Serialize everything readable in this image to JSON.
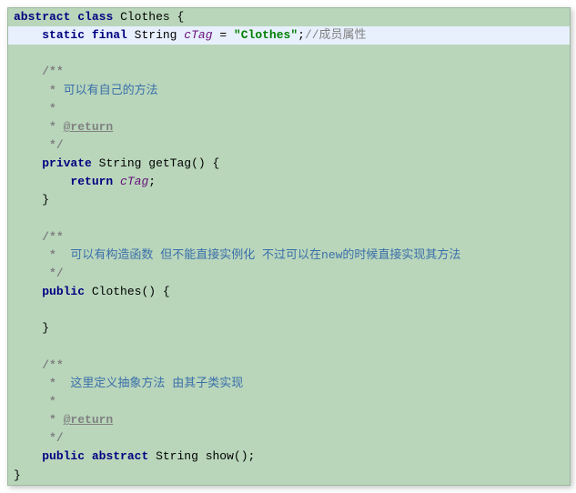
{
  "code": {
    "line1": {
      "kw_abstract": "abstract",
      "kw_class": "class",
      "class_name": "Clothes",
      "brace": "{"
    },
    "line2": {
      "kw_static": "static",
      "kw_final": "final",
      "type": "String",
      "field": "cTag",
      "eq": " = ",
      "str": "\"Clothes\"",
      "semi": ";",
      "comment": "//成员属性"
    },
    "doc1": {
      "open": "/**",
      "l1_star": " *",
      "l1_txt": " 可以有自己的方法",
      "l2_star": " *",
      "l3_star": " * ",
      "l3_tag": "@return",
      "close": " */"
    },
    "method1": {
      "kw_private": "private",
      "type": "String",
      "name": "getTag",
      "parens": "()",
      "brace": " {",
      "kw_return": "return",
      "field": "cTag",
      "semi": ";",
      "close": "}"
    },
    "doc2": {
      "open": "/**",
      "l1_star": " *",
      "l1_txt": "  可以有构造函数 但不能直接实例化 不过可以在new的时候直接实现其方法",
      "close": " */"
    },
    "ctor": {
      "kw_public": "public",
      "name": "Clothes",
      "parens": "()",
      "brace": " {",
      "close": "}"
    },
    "doc3": {
      "open": "/**",
      "l1_star": " *",
      "l1_txt": "  这里定义抽象方法 由其子类实现",
      "l2_star": " *",
      "l3_star": " * ",
      "l3_tag": "@return",
      "close": " */"
    },
    "method2": {
      "kw_public": "public",
      "kw_abstract": "abstract",
      "type": "String",
      "name": "show",
      "parens": "()",
      "semi": ";"
    },
    "close": "}"
  }
}
